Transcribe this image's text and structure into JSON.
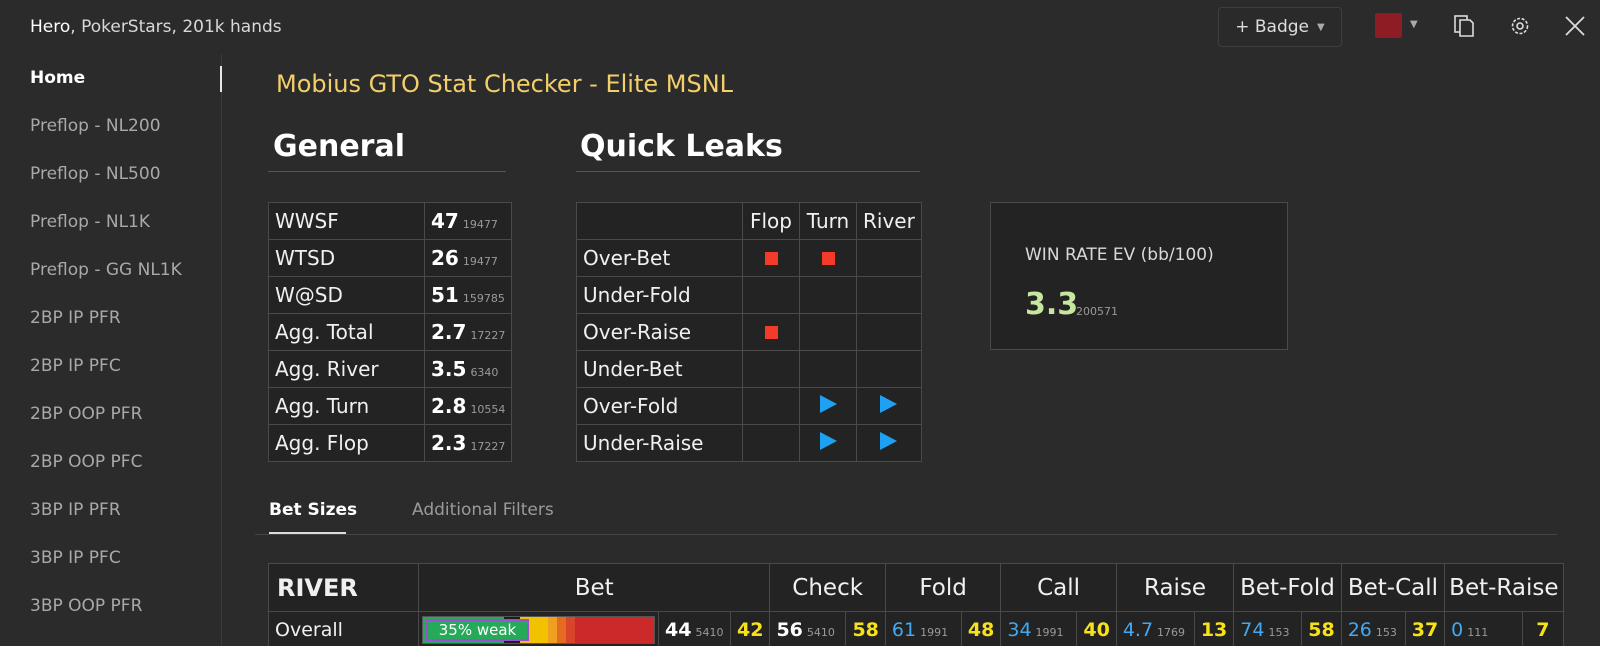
{
  "window": {
    "title_hero": "Hero",
    "title_rest": ", PokerStars, 201k hands",
    "badge_label": "+ Badge",
    "color_swatch": "#8e1c24"
  },
  "sidebar": {
    "items": [
      {
        "label": "Home",
        "active": true
      },
      {
        "label": "Preflop - NL200"
      },
      {
        "label": "Preflop - NL500"
      },
      {
        "label": "Preflop - NL1K"
      },
      {
        "label": "Preflop - GG NL1K"
      },
      {
        "label": "2BP IP PFR"
      },
      {
        "label": "2BP IP PFC"
      },
      {
        "label": "2BP OOP PFR"
      },
      {
        "label": "2BP OOP PFC"
      },
      {
        "label": "3BP IP PFR"
      },
      {
        "label": "3BP IP PFC"
      },
      {
        "label": "3BP OOP PFR"
      }
    ]
  },
  "main": {
    "title": "Mobius GTO Stat Checker - Elite MSNL",
    "general": {
      "heading": "General",
      "rows": [
        {
          "label": "WWSF",
          "value": "47",
          "count": "19477"
        },
        {
          "label": "WTSD",
          "value": "26",
          "count": "19477"
        },
        {
          "label": "W@SD",
          "value": "51",
          "count": "159785"
        },
        {
          "label": "Agg. Total",
          "value": "2.7",
          "count": "17227"
        },
        {
          "label": "Agg. River",
          "value": "3.5",
          "count": "6340"
        },
        {
          "label": "Agg. Turn",
          "value": "2.8",
          "count": "10554"
        },
        {
          "label": "Agg. Flop",
          "value": "2.3",
          "count": "17227"
        }
      ]
    },
    "quick_leaks": {
      "heading": "Quick Leaks",
      "columns": [
        "Flop",
        "Turn",
        "River"
      ],
      "rows": [
        {
          "label": "Over-Bet",
          "marks": [
            "red-square",
            "red-square",
            ""
          ]
        },
        {
          "label": "Under-Fold",
          "marks": [
            "",
            "",
            ""
          ]
        },
        {
          "label": "Over-Raise",
          "marks": [
            "red-square",
            "",
            ""
          ]
        },
        {
          "label": "Under-Bet",
          "marks": [
            "",
            "",
            ""
          ]
        },
        {
          "label": "Over-Fold",
          "marks": [
            "",
            "blue-arrow",
            "blue-arrow"
          ]
        },
        {
          "label": "Under-Raise",
          "marks": [
            "",
            "blue-arrow",
            "blue-arrow"
          ]
        }
      ]
    },
    "win_rate": {
      "label": "WIN RATE EV (bb/100)",
      "value": "3.3",
      "count": "200571"
    },
    "tabs": [
      "Bet Sizes",
      "Additional Filters"
    ],
    "river": {
      "headers": [
        "RIVER",
        "Bet",
        "Check",
        "Fold",
        "Call",
        "Raise",
        "Bet-Fold",
        "Bet-Call",
        "Bet-Raise"
      ],
      "overall": {
        "label": "Overall",
        "weak_label": "35% weak",
        "bet_segments": [
          {
            "color": "#27a95a",
            "share": 0.35
          },
          {
            "color": "#1d1d1d",
            "share": 0.07
          },
          {
            "color": "#f2c200",
            "share": 0.12
          },
          {
            "color": "#f0a020",
            "share": 0.04
          },
          {
            "color": "#e56a22",
            "share": 0.04
          },
          {
            "color": "#d8442c",
            "share": 0.04
          },
          {
            "color": "#cc2a2a",
            "share": 0.34
          }
        ],
        "bet": {
          "value": "44",
          "count": "5410",
          "ref": "42"
        },
        "check": {
          "value": "56",
          "count": "5410",
          "ref": "58"
        },
        "fold": {
          "value": "61",
          "count": "1991",
          "ref": "48"
        },
        "call": {
          "value": "34",
          "count": "1991",
          "ref": "40"
        },
        "raise": {
          "value": "4.7",
          "count": "1769",
          "ref": "13"
        },
        "bet_fold": {
          "value": "74",
          "count": "153",
          "ref": "58"
        },
        "bet_call": {
          "value": "26",
          "count": "153",
          "ref": "37"
        },
        "bet_raise": {
          "value": "0",
          "count": "111",
          "ref": "7"
        }
      }
    }
  }
}
